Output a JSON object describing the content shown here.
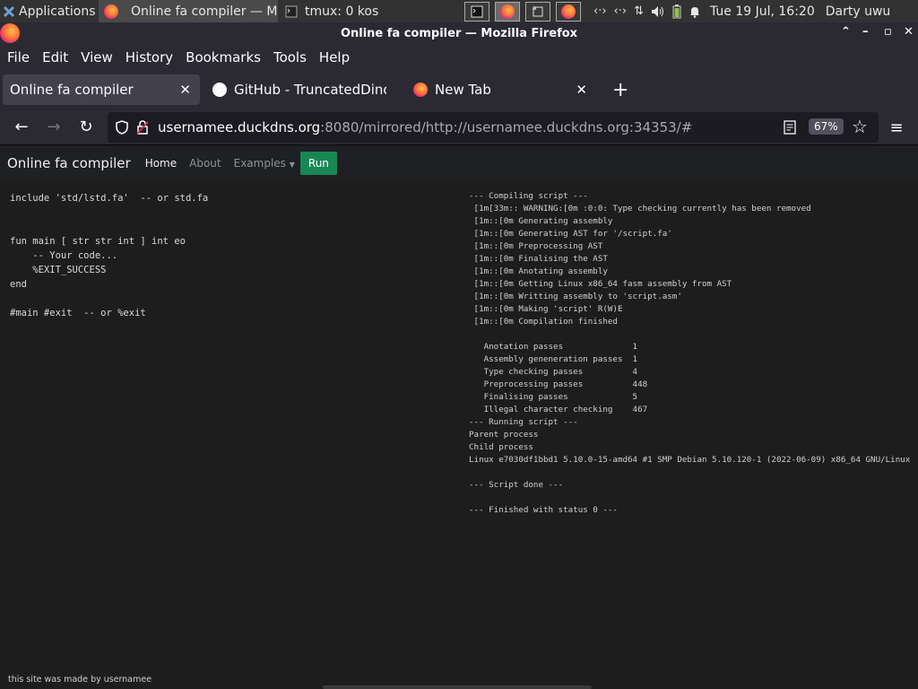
{
  "taskbar": {
    "apps_label": "Applications",
    "windows": [
      {
        "title": "Online fa compiler — M..."
      },
      {
        "title": "tmux: 0 kos"
      }
    ],
    "clock": "Tue 19 Jul, 16:20",
    "user": "Darty uwu"
  },
  "window": {
    "title": "Online fa compiler — Mozilla Firefox"
  },
  "menubar": {
    "items": [
      "File",
      "Edit",
      "View",
      "History",
      "Bookmarks",
      "Tools",
      "Help"
    ]
  },
  "tabs": [
    {
      "label": "Online fa compiler"
    },
    {
      "label": "GitHub - TruncatedDinos"
    },
    {
      "label": "New Tab"
    }
  ],
  "navbar": {
    "url_host": "usernamee.duckdns.org",
    "url_rest": ":8080/mirrored/http://usernamee.duckdns.org:34353/#",
    "zoom": "67%"
  },
  "site": {
    "brand": "Online fa compiler",
    "nav": [
      "Home",
      "About",
      "Examples"
    ],
    "run_label": "Run",
    "footer": "this site was made by usernamee"
  },
  "editor": {
    "code": "include 'std/lstd.fa'  -- or std.fa\n\n\nfun main [ str str int ] int eo\n    -- Your code...\n    %EXIT_SUCCESS\nend\n\n#main #exit  -- or %exit"
  },
  "output": {
    "text": "--- Compiling script ---\n [1m[33m:: WARNING:[0m :0:0: Type checking currently has been removed\n [1m::[0m Generating assembly\n [1m::[0m Generating AST for '/script.fa'\n [1m::[0m Preprocessing AST\n [1m::[0m Finalising the AST\n [1m::[0m Anotating assembly\n [1m::[0m Getting Linux x86_64 fasm assembly from AST\n [1m::[0m Writting assembly to 'script.asm'\n [1m::[0m Making 'script' R(W)E\n [1m::[0m Compilation finished\n\n   Anotation passes              1\n   Assembly geneneration passes  1\n   Type checking passes          4\n   Preprocessing passes          448\n   Finalising passes             5\n   Illegal character checking    467\n--- Running script ---\nParent process\nChild process\nLinux e7030df1bbd1 5.10.0-15-amd64 #1 SMP Debian 5.10.120-1 (2022-06-09) x86_64 GNU/Linux\n\n--- Script done ---\n\n--- Finished with status 0 ---"
  },
  "colors": {
    "accent_run": "#198754",
    "page_bg": "#1d1d1d",
    "chrome_bg": "#2b2a33"
  }
}
